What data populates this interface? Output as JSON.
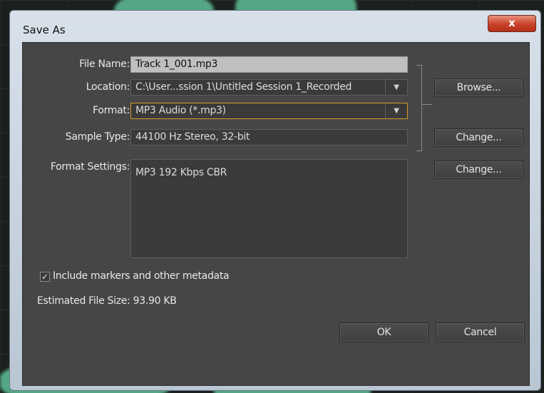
{
  "dialog": {
    "title": "Save As",
    "close_label": "x",
    "file_name": {
      "label": "File Name:",
      "value": "Track 1_001.mp3"
    },
    "location": {
      "label": "Location:",
      "value": "C:\\User...ssion 1\\Untitled Session 1_Recorded"
    },
    "format": {
      "label": "Format:",
      "value": "MP3 Audio (*.mp3)"
    },
    "sample_type": {
      "label": "Sample Type:",
      "value": "44100 Hz Stereo, 32-bit"
    },
    "format_settings": {
      "label": "Format Settings:",
      "value": "MP3 192 Kbps CBR"
    },
    "browse_label": "Browse...",
    "change_label": "Change...",
    "include_metadata": {
      "label": "Include markers and other metadata",
      "checked": true
    },
    "estimated_size": "Estimated File Size: 93.90 KB",
    "ok_label": "OK",
    "cancel_label": "Cancel"
  },
  "icons": {
    "dropdown": "triangle-down",
    "check": "checkmark",
    "close": "x"
  },
  "colors": {
    "focus_border": "#d59a2a",
    "close_button": "#c9412a",
    "panel": "#464646"
  }
}
